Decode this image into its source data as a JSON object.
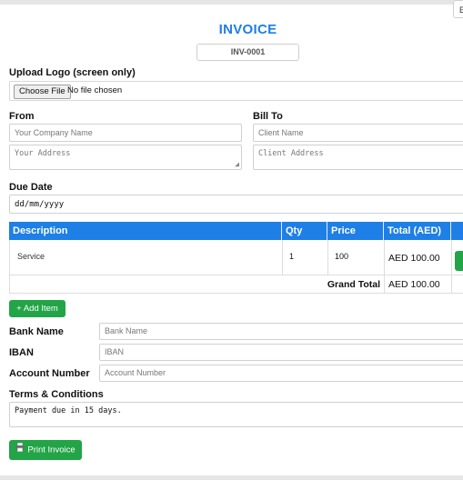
{
  "header": {
    "title": "INVOICE",
    "invoice_number": "INV-0001",
    "corner_label": "E"
  },
  "logo": {
    "label": "Upload Logo (screen only)",
    "button_label": "Choose File",
    "status": "No file chosen"
  },
  "from": {
    "label": "From",
    "company_placeholder": "Your Company Name",
    "address_placeholder": "Your Address"
  },
  "bill_to": {
    "label": "Bill To",
    "client_placeholder": "Client Name",
    "address_placeholder": "Client Address"
  },
  "due_date": {
    "label": "Due Date",
    "value": "dd/mm/yyyy"
  },
  "table": {
    "headers": {
      "description": "Description",
      "qty": "Qty",
      "price": "Price",
      "total": "Total (AED)"
    },
    "items": [
      {
        "description": "Service",
        "qty": "1",
        "price": "100",
        "total": "AED 100.00"
      }
    ],
    "grand_total_label": "Grand Total",
    "grand_total_value": "AED 100.00"
  },
  "add_item_label": "+ Add Item",
  "bank": {
    "name_label": "Bank Name",
    "name_placeholder": "Bank Name",
    "iban_label": "IBAN",
    "iban_placeholder": "IBAN",
    "account_label": "Account Number",
    "account_placeholder": "Account Number"
  },
  "terms": {
    "label": "Terms & Conditions",
    "value": "Payment due in 15 days."
  },
  "print_label": "Print Invoice",
  "colors": {
    "accent": "#1e7fe6",
    "success": "#22a447"
  },
  "icons": {
    "print": "printer-icon"
  }
}
